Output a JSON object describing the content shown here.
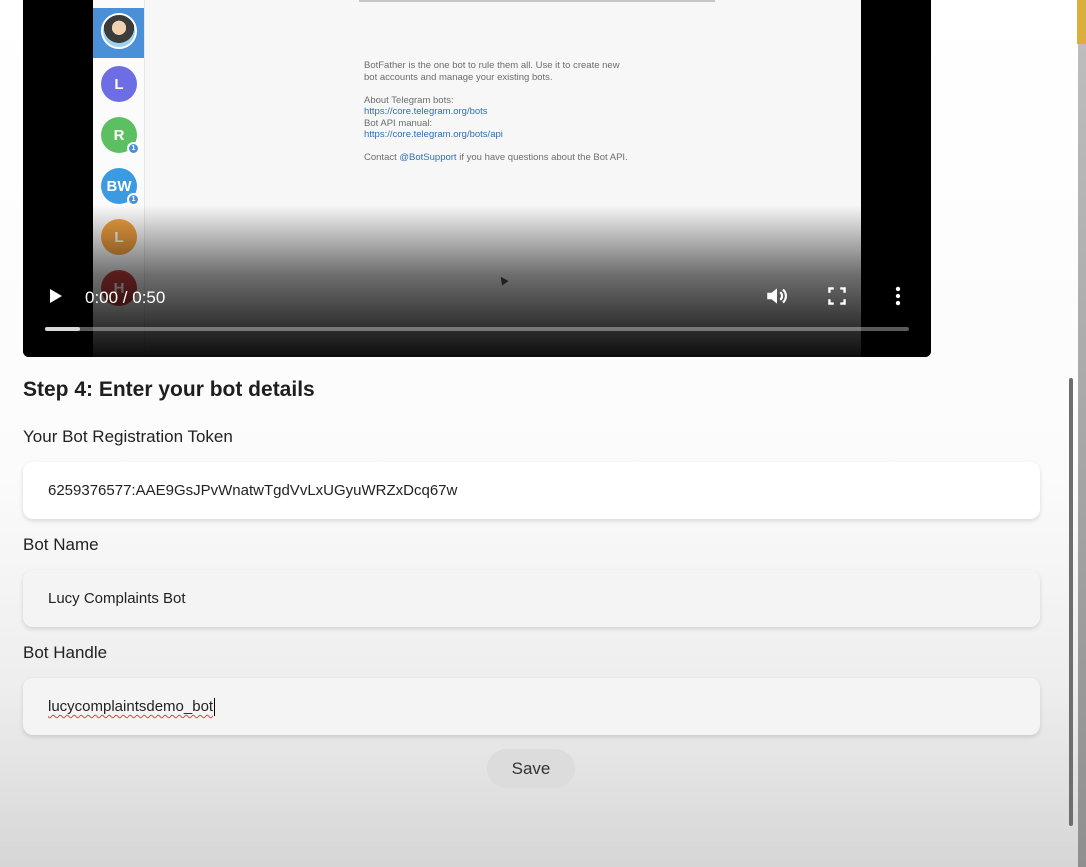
{
  "video": {
    "time_display": "0:00 / 0:50",
    "progress": 0.04,
    "chat_avatars": [
      {
        "initials": "",
        "color": "#4a90d9",
        "badge": ""
      },
      {
        "initials": "L",
        "color": "#6d6de4",
        "badge": ""
      },
      {
        "initials": "R",
        "color": "#5cbf62",
        "badge": "1"
      },
      {
        "initials": "BW",
        "color": "#3b9be0",
        "badge": "1"
      },
      {
        "initials": "L",
        "color": "#f0a040",
        "badge": ""
      },
      {
        "initials": "H",
        "color": "#c44040",
        "badge": ""
      }
    ],
    "bot_info": {
      "line1": "BotFather is the one bot to rule them all. Use it to create new",
      "line2": "bot accounts and manage your existing bots.",
      "about_label": "About Telegram bots:",
      "about_link": "https://core.telegram.org/bots",
      "manual_label": "Bot API manual:",
      "manual_link": "https://core.telegram.org/bots/api",
      "contact_prefix": "Contact",
      "contact_handle": "@BotSupport",
      "contact_suffix": "if you have questions about the Bot API."
    }
  },
  "form": {
    "step_title": "Step 4: Enter your bot details",
    "token_label": "Your Bot Registration Token",
    "token_value": "6259376577:AAE9GsJPvWnatwTgdVvLxUGyuWRZxDcq67w",
    "name_label": "Bot Name",
    "name_value": "Lucy Complaints Bot",
    "handle_label": "Bot Handle",
    "handle_value": "lucycomplaintsdemo_bot",
    "save_label": "Save"
  }
}
